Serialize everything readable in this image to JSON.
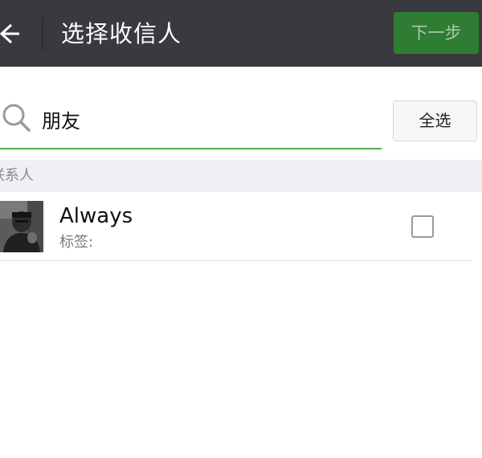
{
  "header": {
    "title": "选择收信人",
    "next_label": "下一步"
  },
  "search": {
    "value": "朋友"
  },
  "select_all_label": "全选",
  "section": {
    "label": "联系人"
  },
  "contacts": [
    {
      "name": "Always",
      "tag_label": "标签:",
      "selected": false
    }
  ],
  "colors": {
    "topbar": "#393a3f",
    "next_button": "#2e7d32",
    "search_underline": "#4caf50",
    "section_bg": "#efeff4"
  },
  "icons": {
    "back": "back-arrow-icon",
    "search": "search-icon",
    "checkbox": "checkbox-icon"
  }
}
